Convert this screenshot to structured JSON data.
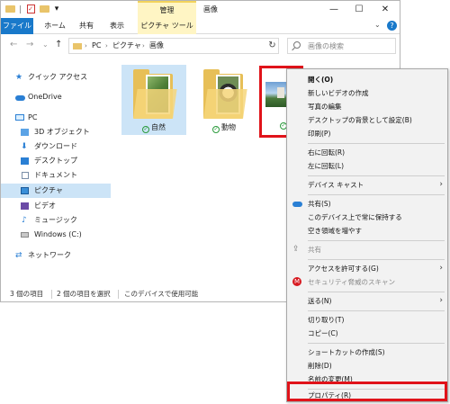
{
  "titlebar": {
    "context_tab": "管理",
    "title": "画像",
    "minimize": "—",
    "maximize": "☐",
    "close": "✕",
    "qa_dropdown": "▾"
  },
  "ribbon": {
    "tabs": [
      "ファイル",
      "ホーム",
      "共有",
      "表示",
      "ピクチャ ツール"
    ],
    "expand": "⌄",
    "help": "?"
  },
  "address": {
    "back": "←",
    "forward": "→",
    "recent": "⌄",
    "up": "↑",
    "crumbs": [
      "PC",
      "ピクチャ",
      "画像"
    ],
    "separator": "›",
    "refresh": "↻",
    "search_placeholder": "画像の検索"
  },
  "navpane": {
    "items": [
      {
        "label": "クイック アクセス",
        "icon": "star-icon"
      },
      {
        "label": "OneDrive",
        "icon": "cloud-icon"
      },
      {
        "label": "PC",
        "icon": "pc-icon"
      },
      {
        "label": "3D オブジェクト",
        "icon": "3d-objects-icon"
      },
      {
        "label": "ダウンロード",
        "icon": "download-icon"
      },
      {
        "label": "デスクトップ",
        "icon": "desktop-icon"
      },
      {
        "label": "ドキュメント",
        "icon": "document-icon"
      },
      {
        "label": "ピクチャ",
        "icon": "pictures-icon",
        "selected": true
      },
      {
        "label": "ビデオ",
        "icon": "video-icon"
      },
      {
        "label": "ミュージック",
        "icon": "music-icon"
      },
      {
        "label": "Windows (C:)",
        "icon": "drive-icon"
      },
      {
        "label": "ネットワーク",
        "icon": "network-icon"
      }
    ]
  },
  "content": {
    "folders": [
      {
        "name": "自然",
        "selected": true
      },
      {
        "name": "動物",
        "selected": false
      }
    ],
    "image_status": "✓"
  },
  "status": {
    "count": "3 個の項目",
    "selection": "2 個の項目を選択",
    "availability": "このデバイスで使用可能"
  },
  "menu": {
    "items": [
      {
        "label": "開く(O)"
      },
      {
        "label": "新しいビデオの作成"
      },
      {
        "label": "写真の編集"
      },
      {
        "label": "デスクトップの背景として設定(B)"
      },
      {
        "label": "印刷(P)"
      },
      {
        "label": "右に回転(R)"
      },
      {
        "label": "左に回転(L)"
      },
      {
        "label": "デバイス キャスト",
        "submenu": true
      },
      {
        "label": "共有(S)",
        "icon": "onedrive-icon"
      },
      {
        "label": "このデバイス上で常に保持する"
      },
      {
        "label": "空き領域を増やす"
      },
      {
        "label": "共有",
        "icon": "share-icon",
        "disabled": true
      },
      {
        "label": "アクセスを許可する(G)",
        "submenu": true
      },
      {
        "label": "セキュリティ脅威のスキャン",
        "icon": "mcafee-icon",
        "disabled": true
      },
      {
        "label": "送る(N)",
        "submenu": true
      },
      {
        "label": "切り取り(T)"
      },
      {
        "label": "コピー(C)"
      },
      {
        "label": "ショートカットの作成(S)"
      },
      {
        "label": "削除(D)"
      },
      {
        "label": "名前の変更(M)"
      },
      {
        "label": "プロパティ(R)",
        "highlighted": true
      }
    ],
    "submenu_arrow": "›"
  },
  "colors": {
    "accent": "#1979ca",
    "selection": "#cce4f7",
    "highlight_box": "#e0131a",
    "context_tab": "#fff5c4"
  }
}
